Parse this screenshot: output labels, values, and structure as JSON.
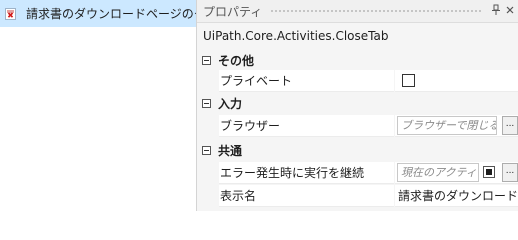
{
  "left_panel": {
    "activity_label": "請求書のダウンロードページのタ",
    "activity_icon": "close-tab-icon"
  },
  "properties_panel": {
    "title": "プロパティ",
    "type_name": "UiPath.Core.Activities.CloseTab",
    "pin_glyph": "ᴾ",
    "categories": [
      {
        "label": "その他",
        "properties": [
          {
            "name": "プライベート",
            "editor": "checkbox",
            "checked": false
          }
        ]
      },
      {
        "label": "入力",
        "properties": [
          {
            "name": "ブラウザー",
            "editor": "text",
            "placeholder": "ブラウザーで閉じるタ",
            "button": "..."
          }
        ]
      },
      {
        "label": "共通",
        "properties": [
          {
            "name": "エラー発生時に実行を継続",
            "editor": "text",
            "placeholder": "現在のアクティ",
            "button": "..."
          },
          {
            "name": "表示名",
            "editor": "static",
            "value": "請求書のダウンロードペー"
          }
        ]
      }
    ]
  }
}
